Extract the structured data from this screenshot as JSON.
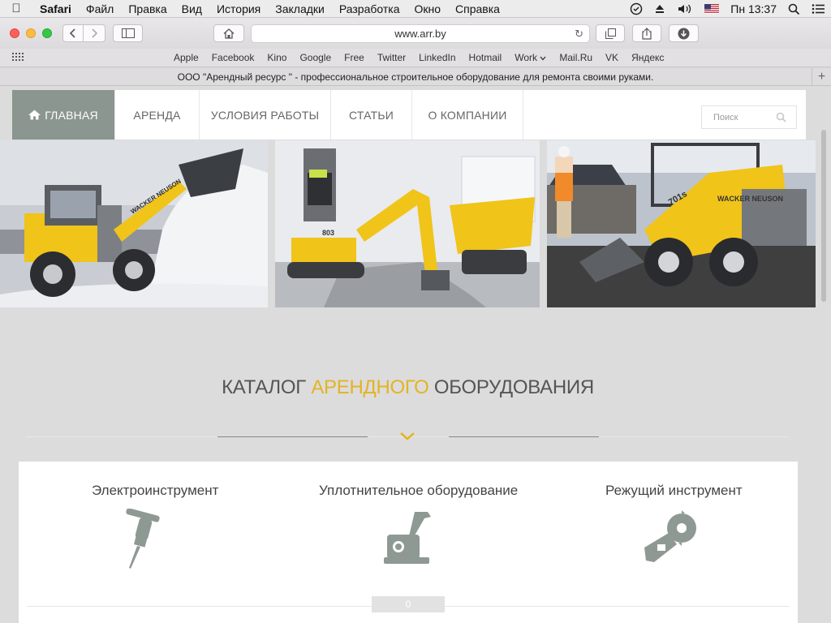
{
  "menubar": {
    "app": "Safari",
    "items": [
      "Файл",
      "Правка",
      "Вид",
      "История",
      "Закладки",
      "Разработка",
      "Окно",
      "Справка"
    ],
    "clock": "Пн 13:37"
  },
  "toolbar": {
    "url": "www.arr.by"
  },
  "bookmarks": [
    "Apple",
    "Facebook",
    "Kino",
    "Google",
    "Free",
    "Twitter",
    "LinkedIn",
    "Hotmail",
    "Work",
    "Mail.Ru",
    "VK",
    "Яндекс"
  ],
  "tab": {
    "title": "ООО \"Арендный ресурс \" - профессиональное строительное оборудование для ремонта своими руками.",
    "new_tab": "+"
  },
  "site": {
    "nav": {
      "items": [
        "ГЛАВНАЯ",
        "АРЕНДА",
        "УСЛОВИЯ РАБОТЫ",
        "СТАТЬИ",
        "О КОМПАНИИ"
      ],
      "search_placeholder": "Поиск"
    },
    "banner": {
      "brand_1": "WACKER NEUSON",
      "brand_2": "WACKER NEUSON",
      "model_2": "701s"
    },
    "catalog": {
      "title_before": "КАТАЛОГ ",
      "title_accent": "АРЕНДНОГО",
      "title_after": " ОБОРУДОВАНИЯ",
      "categories": [
        {
          "label": "Электроинструмент",
          "icon": "jackhammer-icon"
        },
        {
          "label": "Уплотнительное оборудование",
          "icon": "plate-compactor-icon"
        },
        {
          "label": "Режущий инструмент",
          "icon": "circular-saw-icon"
        }
      ],
      "pager": "0"
    }
  },
  "colors": {
    "accent": "#e4b324",
    "nav_active": "#8a968f",
    "icon_gray": "#8f9994",
    "machine_yellow": "#f0c419"
  }
}
